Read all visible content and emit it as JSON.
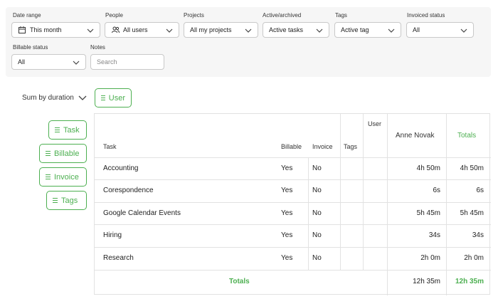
{
  "filters": {
    "date_range": {
      "label": "Date range",
      "value": "This month"
    },
    "people": {
      "label": "People",
      "value": "All users"
    },
    "projects": {
      "label": "Projects",
      "value": "All my projects"
    },
    "active_archived": {
      "label": "Active/archived",
      "value": "Active tasks"
    },
    "tags": {
      "label": "Tags",
      "value": "Active tag"
    },
    "invoiced_status": {
      "label": "Invoiced status",
      "value": "All"
    },
    "billable_status": {
      "label": "Billable status",
      "value": "All"
    },
    "notes": {
      "label": "Notes",
      "placeholder": "Search"
    }
  },
  "sum_by": {
    "label": "Sum by duration"
  },
  "group_chips": {
    "user": "User",
    "task": "Task",
    "billable": "Billable",
    "invoice": "Invoice",
    "tags": "Tags"
  },
  "table": {
    "headers": {
      "user": "User",
      "task": "Task",
      "billable": "Billable",
      "invoice": "Invoice",
      "tags": "Tags",
      "person": "Anne Novak",
      "totals": "Totals"
    },
    "rows": [
      {
        "task": "Accounting",
        "billable": "Yes",
        "invoice": "No",
        "person": "4h 50m",
        "total": "4h 50m"
      },
      {
        "task": "Corespondence",
        "billable": "Yes",
        "invoice": "No",
        "person": "6s",
        "total": "6s"
      },
      {
        "task": "Google Calendar Events",
        "billable": "Yes",
        "invoice": "No",
        "person": "5h 45m",
        "total": "5h 45m"
      },
      {
        "task": "Hiring",
        "billable": "Yes",
        "invoice": "No",
        "person": "34s",
        "total": "34s"
      },
      {
        "task": "Research",
        "billable": "Yes",
        "invoice": "No",
        "person": "2h 0m",
        "total": "2h 0m"
      }
    ],
    "footer": {
      "label": "Totals",
      "person": "12h 35m",
      "total": "12h 35m"
    }
  },
  "colors": {
    "accent": "#4caf50",
    "border": "#e2e2e2",
    "panel": "#f6f6f6"
  }
}
